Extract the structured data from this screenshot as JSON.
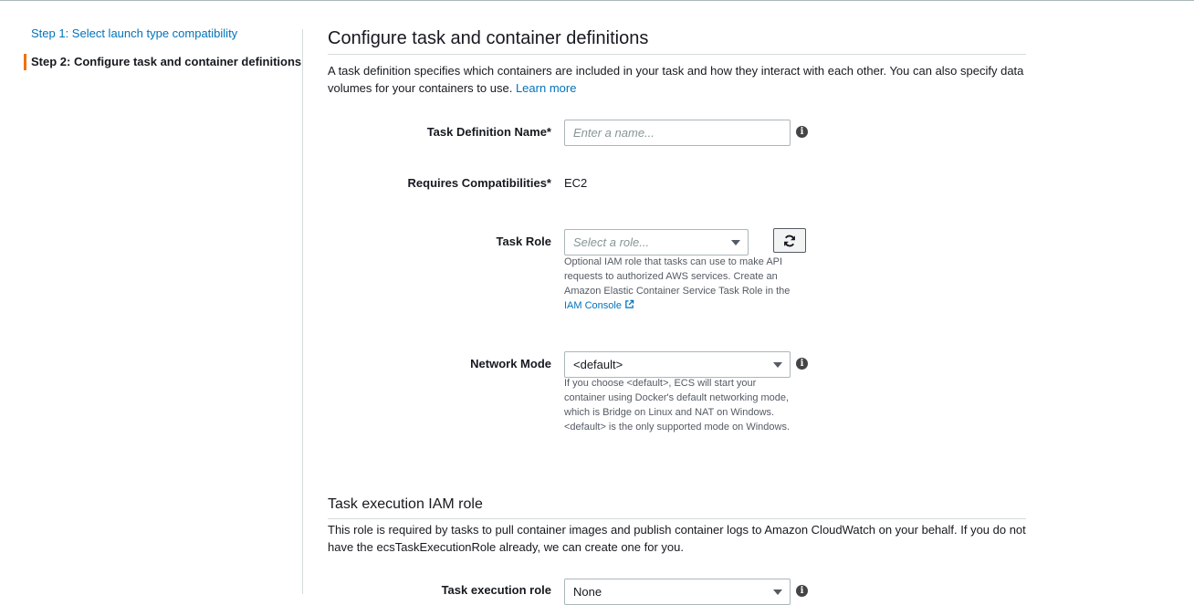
{
  "steps": [
    {
      "label": "Step 1: Select launch type compatibility"
    },
    {
      "label": "Step 2: Configure task and container definitions"
    }
  ],
  "section": {
    "title": "Configure task and container definitions",
    "description": "A task definition specifies which containers are included in your task and how they interact with each other. You can also specify data volumes for your containers to use.",
    "learn_more": "Learn more"
  },
  "task_definition_name": {
    "label": "Task Definition Name*",
    "placeholder": "Enter a name...",
    "value": ""
  },
  "requires_compatibilities": {
    "label": "Requires Compatibilities*",
    "value": "EC2"
  },
  "task_role": {
    "label": "Task Role",
    "placeholder": "Select a role...",
    "help": "Optional IAM role that tasks can use to make API requests to authorized AWS services. Create an Amazon Elastic Container Service Task Role in the",
    "help_link": "IAM Console"
  },
  "network_mode": {
    "label": "Network Mode",
    "value": "<default>",
    "help": "If you choose <default>, ECS will start your container using Docker's default networking mode, which is Bridge on Linux and NAT on Windows. <default> is the only supported mode on Windows."
  },
  "execution_section": {
    "title": "Task execution IAM role",
    "description": "This role is required by tasks to pull container images and publish container logs to Amazon CloudWatch on your behalf. If you do not have the ecsTaskExecutionRole already, we can create one for you."
  },
  "task_execution_role": {
    "label": "Task execution role",
    "value": "None"
  },
  "icons": {
    "info": "info-icon",
    "refresh": "refresh-icon",
    "external": "external-link-icon",
    "dropdown": "chevron-down-icon"
  },
  "colors": {
    "link": "#0073bb",
    "active_step_accent": "#ec7211",
    "text": "#16191f"
  }
}
